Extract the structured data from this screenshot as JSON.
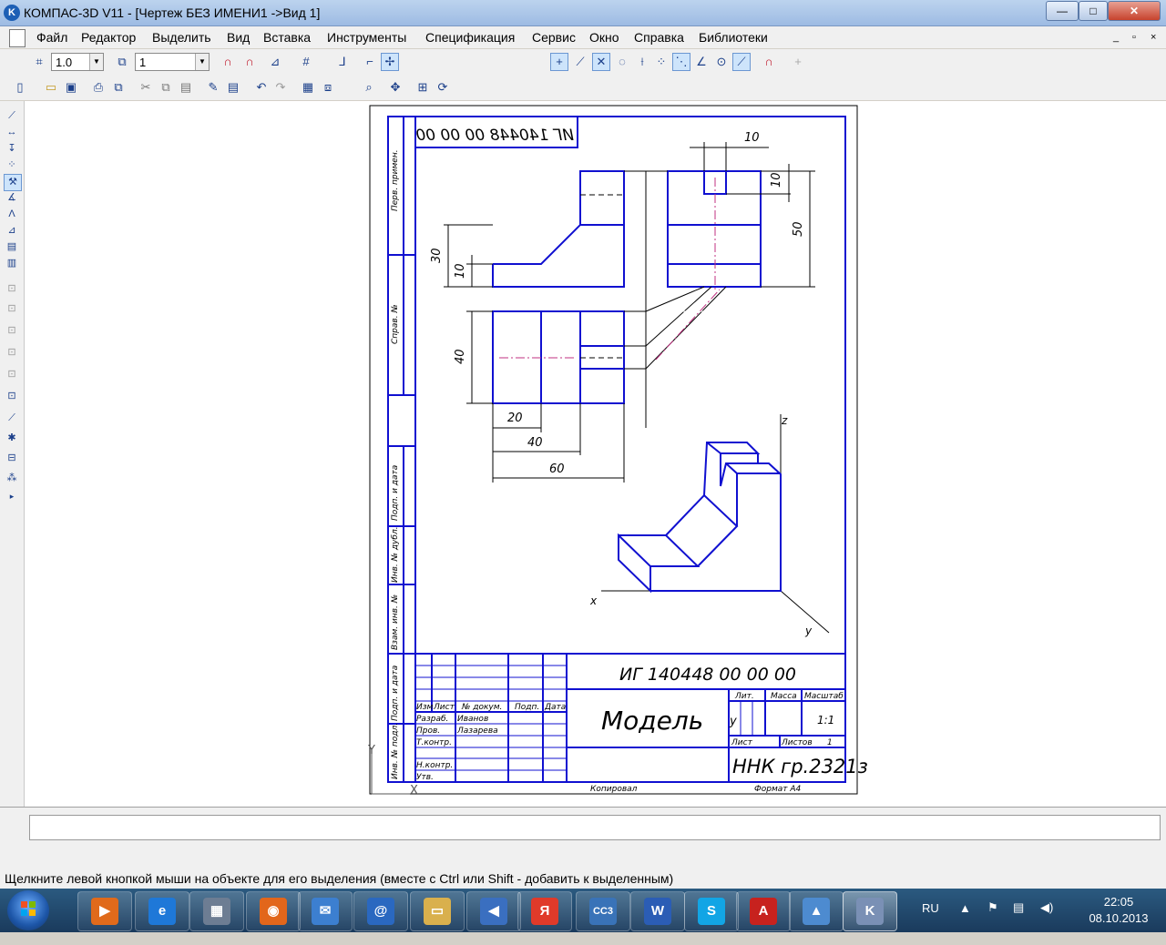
{
  "window": {
    "app_icon_letter": "K",
    "title": "КОМПАС-3D V11 - [Чертеж БЕЗ ИМЕНИ1 ->Вид 1]",
    "min": "—",
    "max": "□",
    "close": "✕"
  },
  "menu": {
    "items": [
      "Файл",
      "Редактор",
      "Выделить",
      "Вид",
      "Вставка",
      "Инструменты",
      "Спецификация",
      "Сервис",
      "Окно",
      "Справка",
      "Библиотеки"
    ],
    "mdi": [
      "_",
      "▫",
      "×"
    ]
  },
  "toolbar": {
    "scale_value": "1.0",
    "layer_value": "1"
  },
  "drawing": {
    "stamp_top": "ИГ 140448 00 00 00",
    "designation": "ИГ 140448 00 00 00",
    "part_name": "Модель",
    "group": "ННК гр.2321з",
    "scale": "1:1",
    "lit_letter": "у",
    "headers": {
      "lit": "Лит.",
      "mass": "Масса",
      "scale": "Масштаб",
      "sheet": "Лист",
      "sheets": "Листов",
      "sheets_count": "1"
    },
    "side_labels": [
      "Перв. примен.",
      "Справ. №",
      "Подп. и дата",
      "Инв. № дубл.",
      "Взам. инв. №",
      "Подп. и дата",
      "Инв. № подл."
    ],
    "rows": {
      "izm": "Изм",
      "list": "Лист",
      "ndoc": "№ докум.",
      "podp": "Подп.",
      "data": "Дата",
      "razrab": "Разраб.",
      "razrab_name": "Иванов",
      "prov": "Пров.",
      "prov_name": "Лазарева",
      "tkontr": "Т.контр.",
      "nkontr": "Н.контр.",
      "utv": "Утв."
    },
    "footer_copy": "Копировал",
    "footer_format": "Формат   А4",
    "dims": {
      "d10_top": "10",
      "d10_right": "10",
      "d50": "50",
      "d30": "30",
      "d10_left": "10",
      "d40_left": "40",
      "d20": "20",
      "d40": "40",
      "d60": "60"
    },
    "axes": {
      "x": "x",
      "y": "y",
      "z": "z",
      "coord_x": "X",
      "coord_y": "Y"
    }
  },
  "status": {
    "hint": "Щелкните левой кнопкой мыши на объекте для его выделения (вместе с Ctrl или Shift - добавить к выделенным)"
  },
  "taskbar": {
    "apps": [
      {
        "name": "media-player",
        "glyph": "▶",
        "color": "#e06a1b"
      },
      {
        "name": "internet-explorer",
        "glyph": "e",
        "color": "#1e78d8"
      },
      {
        "name": "calculator",
        "glyph": "▦",
        "color": "#6d7d93"
      },
      {
        "name": "firefox",
        "glyph": "◉",
        "color": "#e2661b"
      },
      {
        "name": "mail",
        "glyph": "✉",
        "color": "#3c7fd0"
      },
      {
        "name": "internet",
        "glyph": "@",
        "color": "#2a68c0"
      },
      {
        "name": "folder",
        "glyph": "▭",
        "color": "#d9b04d"
      },
      {
        "name": "volume",
        "glyph": "◀",
        "color": "#3a6fc0"
      },
      {
        "name": "yandex",
        "glyph": "Я",
        "color": "#e03a2a"
      },
      {
        "name": "css",
        "glyph": "CC3",
        "color": "#3973b8"
      },
      {
        "name": "word",
        "glyph": "W",
        "color": "#2b5db5"
      },
      {
        "name": "skype",
        "glyph": "S",
        "color": "#12a5e5"
      },
      {
        "name": "acrobat",
        "glyph": "A",
        "color": "#c7221e"
      },
      {
        "name": "image-viewer",
        "glyph": "▲",
        "color": "#4d8bd0"
      },
      {
        "name": "kompas",
        "glyph": "K",
        "color": "#7a90b5"
      }
    ],
    "lang": "RU",
    "time": "22:05",
    "date": "08.10.2013"
  }
}
